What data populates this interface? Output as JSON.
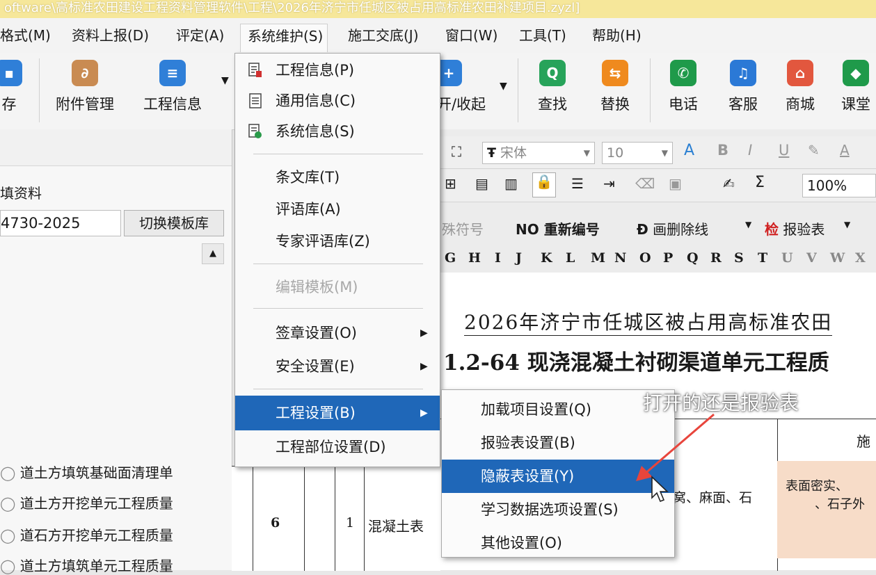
{
  "title_bar": {
    "text": "oftware\\高标准农田建设工程资料管理软件\\工程\\2026年济宁市任城区被占用高标准农田补建项目.zyzl]"
  },
  "menubar": {
    "items": [
      "格式(M)",
      "资料上报(D)",
      "评定(A)",
      "系统维护(S)",
      "施工交底(J)",
      "窗口(W)",
      "工具(T)",
      "帮助(H)"
    ]
  },
  "toolbar": {
    "buttons": [
      {
        "label": "存",
        "icon": "save-icon",
        "color": "#2f7fd8"
      },
      {
        "label": "附件管理",
        "icon": "attachment-icon",
        "color": "#c98b52"
      },
      {
        "label": "工程信息",
        "icon": "document-icon",
        "color": "#2f7fd8"
      },
      {
        "label": "开/收起",
        "icon": "expand-icon",
        "color": "#2f7fd8"
      },
      {
        "label": "查找",
        "icon": "search-icon",
        "color": "#27a35a"
      },
      {
        "label": "替换",
        "icon": "replace-icon",
        "color": "#ef8a1e"
      },
      {
        "label": "电话",
        "icon": "phone-icon",
        "color": "#1f9a4a"
      },
      {
        "label": "客服",
        "icon": "headset-icon",
        "color": "#2b79d6"
      },
      {
        "label": "商城",
        "icon": "shop-icon",
        "color": "#e2573e"
      },
      {
        "label": "课堂",
        "icon": "graduation-icon",
        "color": "#1f9a4a"
      }
    ]
  },
  "left_panel": {
    "section_title": "填资料",
    "standard_code": "4730-2025",
    "switch_button": "切换模板库",
    "tree_items": [
      "道土方填筑基础面清理单",
      "道土方开挖单元工程质量",
      "道石方开挖单元工程质量",
      "道土方填筑单元工程质量"
    ]
  },
  "format_bar": {
    "font_name": "宋体",
    "font_size": "10",
    "zoom": "100%",
    "special_chars": "殊符号",
    "renumber": "NO 重新编号",
    "strikethrough": "画删除线",
    "inspection_table": "报验表",
    "sum_symbol": "Σ"
  },
  "column_letters": [
    "G",
    "H",
    "I",
    "J",
    "K",
    "L",
    "M",
    "N",
    "O",
    "P",
    "Q",
    "R",
    "S",
    "T",
    "U",
    "V",
    "W",
    "X"
  ],
  "document": {
    "header_line": "2026年济宁市任城区被占用高标准农田",
    "form_title": "1.2-64 现浇混凝土衬砌渠道单元工程质",
    "row": {
      "no": "6",
      "sub_no": "1",
      "item": "混凝土表",
      "desc": "窝、麻面、石",
      "desc2": "表面密实、",
      "desc3": "、石子外",
      "right_header": "施"
    }
  },
  "system_menu": {
    "items": [
      {
        "label": "工程信息(P)",
        "icon": "project-info-icon"
      },
      {
        "label": "通用信息(C)",
        "icon": "general-info-icon"
      },
      {
        "label": "系统信息(S)",
        "icon": "system-info-icon"
      },
      {
        "label": "条文库(T)"
      },
      {
        "label": "评语库(A)"
      },
      {
        "label": "专家评语库(Z)"
      },
      {
        "label": "编辑模板(M)",
        "disabled": true
      },
      {
        "label": "签章设置(O)",
        "submenu": true
      },
      {
        "label": "安全设置(E)",
        "submenu": true
      },
      {
        "label": "工程设置(B)",
        "submenu": true,
        "highlighted": true
      },
      {
        "label": "工程部位设置(D)"
      }
    ]
  },
  "project_settings_submenu": {
    "items": [
      {
        "label": "加载项目设置(Q)"
      },
      {
        "label": "报验表设置(B)"
      },
      {
        "label": "隐蔽表设置(Y)",
        "highlighted": true
      },
      {
        "label": "学习数据选项设置(S)"
      },
      {
        "label": "其他设置(O)"
      }
    ]
  },
  "annotation": {
    "text": "打开的还是报验表",
    "arrow_color": "#e8453c"
  },
  "colors": {
    "highlight": "#1f67b8",
    "annotation_arrow": "#e8453c"
  }
}
